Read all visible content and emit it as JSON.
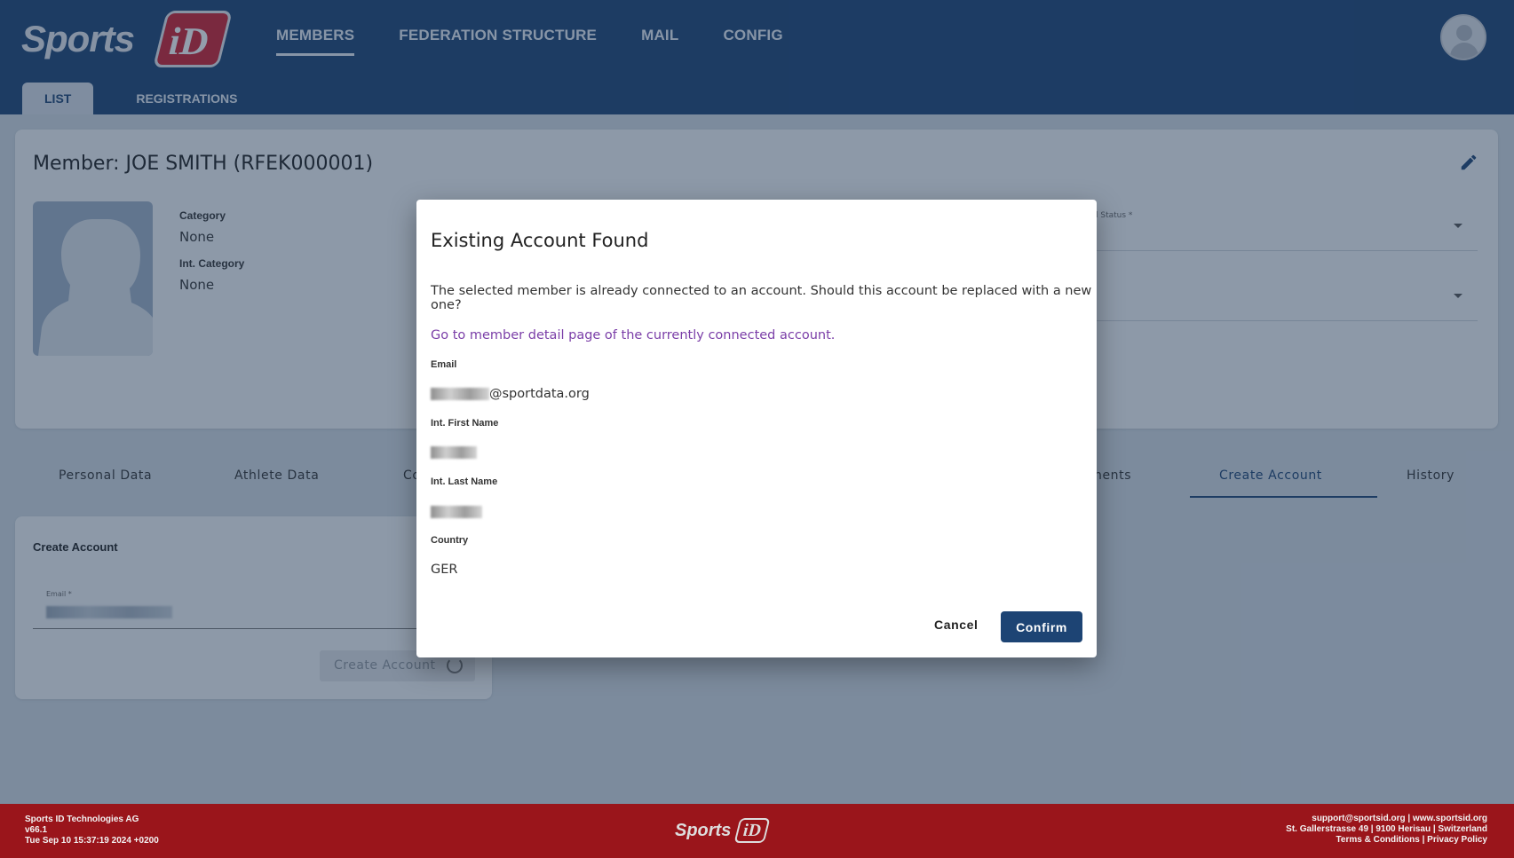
{
  "header": {
    "logo_text": "Sports",
    "logo_badge": "iD",
    "nav": [
      "MEMBERS",
      "FEDERATION STRUCTURE",
      "MAIL",
      "CONFIG"
    ],
    "active_nav": "MEMBERS",
    "subtabs": [
      "LIST",
      "REGISTRATIONS"
    ],
    "active_subtab": "LIST"
  },
  "member": {
    "title": "Member: JOE SMITH (RFEK000001)",
    "category_label": "Category",
    "category_value": "None",
    "int_category_label": "Int. Category",
    "int_category_value": "None",
    "status_label": "l Status *"
  },
  "tabs": {
    "items": [
      "Personal Data",
      "Athlete Data",
      "Co",
      "nents",
      "Create Account",
      "History"
    ],
    "active": "Create Account"
  },
  "create_account": {
    "title": "Create Account",
    "email_label": "Email *",
    "button_label": "Create Account"
  },
  "dialog": {
    "title": "Existing Account Found",
    "message": "The selected member is already connected to an account. Should this account be replaced with a new one?",
    "link": "Go to member detail page of the currently connected account.",
    "email_label": "Email",
    "email_domain": "@sportdata.org",
    "first_name_label": "Int. First Name",
    "last_name_label": "Int. Last Name",
    "country_label": "Country",
    "country_value": "GER",
    "cancel_label": "Cancel",
    "confirm_label": "Confirm"
  },
  "footer": {
    "company": "Sports ID Technologies AG",
    "version": "v66.1",
    "build_date": "Tue Sep 10 15:37:19 2024 +0200",
    "contact": "support@sportsid.org | www.sportsid.org",
    "address": "St. Gallerstrasse 49 | 9100 Herisau | Switzerland",
    "legal": "Terms & Conditions | Privacy Policy"
  },
  "colors": {
    "header": "#1d4474",
    "footer": "#9a151b",
    "primary_button": "#1d4474",
    "link": "#7b3fa8"
  }
}
